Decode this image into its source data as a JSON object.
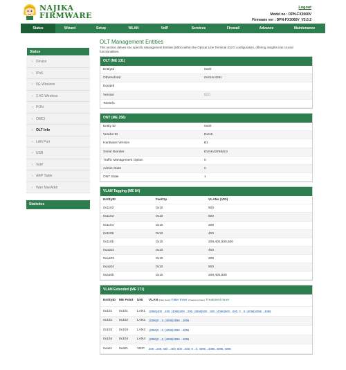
{
  "header": {
    "logo_line1": "NAJIKA",
    "logo_line2": "FIRMWARE",
    "logout": "Logout",
    "model": "Model no : DPN-FX3060V",
    "firmware": "Firmware ver : DPN-FX3060V_V2.0.2"
  },
  "nav": [
    {
      "label": "Status",
      "active": true
    },
    {
      "label": "Wizard"
    },
    {
      "label": "Setup"
    },
    {
      "label": "WLAN"
    },
    {
      "label": "VoIP"
    },
    {
      "label": "Services"
    },
    {
      "label": "Firewall"
    },
    {
      "label": "Advance"
    },
    {
      "label": "Maintenance"
    }
  ],
  "sidebar": {
    "heading": "Status",
    "items": [
      {
        "label": "Device"
      },
      {
        "label": "IPv6"
      },
      {
        "label": "5G Wireless"
      },
      {
        "label": "2.4G Wireless"
      },
      {
        "label": "PON"
      },
      {
        "label": "OMCI"
      },
      {
        "label": "OLT Info",
        "active": true
      },
      {
        "label": "LAN Port"
      },
      {
        "label": "USB"
      },
      {
        "label": "VoIP"
      },
      {
        "label": "ARP Table"
      },
      {
        "label": "Wan MacAddr"
      }
    ],
    "stats_heading": "Statistics"
  },
  "main": {
    "title": "OLT Management Entities",
    "description": "This section delves into specific Management Entities (MEs) within the Optical Line Terminal (OLT) configuration, offering insights into crucial functionalities.",
    "olt": {
      "heading": "OLT (ME 131)",
      "rows": [
        {
          "key": "EntityId",
          "value": "0x00"
        },
        {
          "key": "OltVendorId",
          "value": "0x414c434c"
        },
        {
          "key": "EquipId",
          "value": ""
        },
        {
          "key": "Version",
          "value": "□□□"
        },
        {
          "key": "ToDInfo",
          "value": ""
        }
      ]
    },
    "ont": {
      "heading": "ONT (ME 256)",
      "rows": [
        {
          "key": "Entity ID",
          "value": "0x00"
        },
        {
          "key": "Vendor ID",
          "value": "DLNK"
        },
        {
          "key": "Hardware Version",
          "value": "B1"
        },
        {
          "key": "Serial Number",
          "value": "DLNK4376ddc3"
        },
        {
          "key": "Traffic Management Option",
          "value": "0"
        },
        {
          "key": "Admin State",
          "value": "0"
        },
        {
          "key": "ONT State",
          "value": "1"
        }
      ]
    },
    "vlan_tagging": {
      "heading": "VLAN Tagging (ME 84)",
      "columns": [
        "EntityID",
        "FwdOp",
        "VLANs (VID)"
      ],
      "rows": [
        [
          "0x1102",
          "0x10",
          "500"
        ],
        [
          "0x1103",
          "0x10",
          "600"
        ],
        [
          "0x1104",
          "0x10",
          "209"
        ],
        [
          "0x1105",
          "0x10",
          "400"
        ],
        [
          "0x110b",
          "0x10",
          "209,400,500,600"
        ],
        [
          "0xa102",
          "0x10",
          "400"
        ],
        [
          "0xa103",
          "0x10",
          "209"
        ],
        [
          "0xa104",
          "0x10",
          "500"
        ],
        [
          "0xa10b",
          "0x10",
          "209,400,500"
        ]
      ]
    },
    "vlan_extended": {
      "heading": "VLAN Extended (ME 171)",
      "columns": {
        "entity": "EntityID",
        "me_point": "ME Point",
        "uni": "UNI",
        "vlan": "VLAN",
        "filter_outer": "(Filter Outer)",
        "filter_inner": "Filter Inner",
        "treatment_outer": "(Treatment Outer)",
        "treatment_inner": "Treatment Inner"
      },
      "rows": [
        [
          "0x101",
          "0x101",
          "LAN1",
          "(4096)400→400, (4096)209→209, (4096)500→500, (4096)600→600, 0→0, (4096)4096→4096"
        ],
        [
          "0x102",
          "0x102",
          "LAN2",
          "(4096)0→0, (4096)4096→4096"
        ],
        [
          "0x103",
          "0x103",
          "LAN3",
          "(4096)0→0, (4096)4096→4096"
        ],
        [
          "0x104",
          "0x104",
          "LAN4",
          "(4096)0→0, (4096)4096→4096"
        ],
        [
          "0xa01",
          "0xa01",
          "VEIP",
          "209→209, 400→400, 500→500, 0→0, 4096→4096, 4096, 4096"
        ]
      ]
    }
  }
}
